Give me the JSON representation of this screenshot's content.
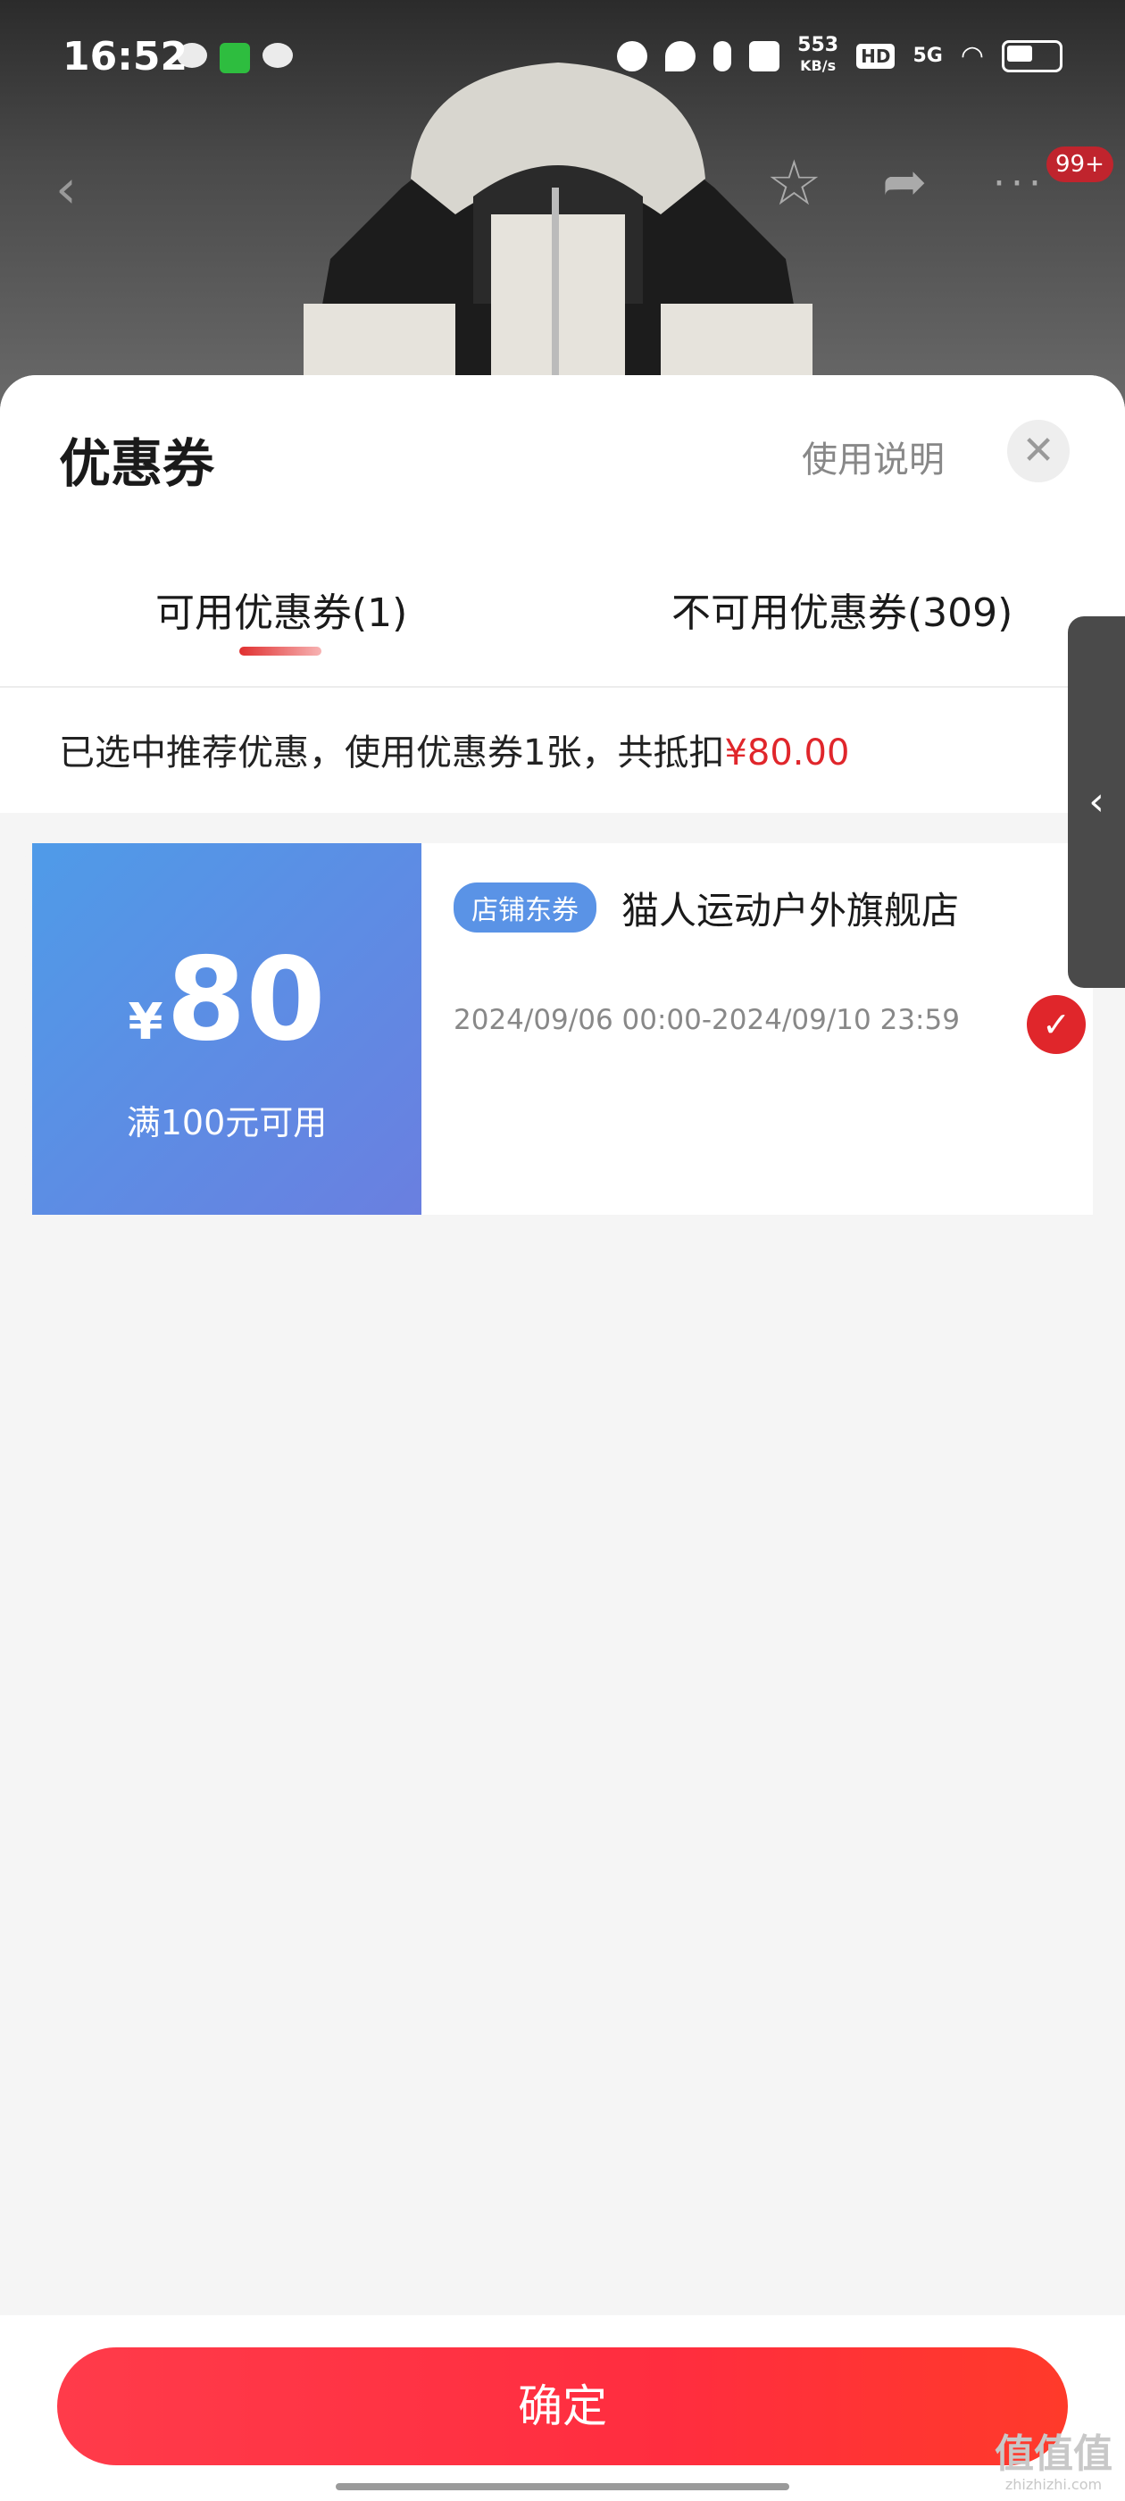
{
  "status_bar": {
    "time": "16:52",
    "net_speed": "553",
    "net_unit": "KB/s",
    "hd": "HD",
    "signal": "5G"
  },
  "product_nav": {
    "back_icon": "chevron-left-icon",
    "badge": "99+"
  },
  "sheet": {
    "title": "优惠券",
    "usage_link": "使用说明",
    "close_icon": "close-icon",
    "tabs": [
      {
        "label": "可用优惠券(1)",
        "active": true
      },
      {
        "label": "不可用优惠券(309)",
        "active": false
      }
    ],
    "summary_text": "已选中推荐优惠，使用优惠券1张，共抵扣",
    "summary_amount": "¥80.00"
  },
  "coupon": {
    "currency": "¥",
    "value": "80",
    "condition": "满100元可用",
    "tag": "店铺东券",
    "store": "猫人运动户外旗舰店",
    "validity": "2024/09/06 00:00-2024/09/10 23:59",
    "selected": true,
    "colors": {
      "left_start": "#4f9be8",
      "left_end": "#6a7fe0",
      "check": "#e0262b"
    }
  },
  "footer": {
    "confirm_label": "确定"
  },
  "watermark": {
    "text": "值值值",
    "url": "zhizhizhi.com"
  },
  "colors": {
    "accent": "#e0262b",
    "button": "#ff3b4a"
  }
}
